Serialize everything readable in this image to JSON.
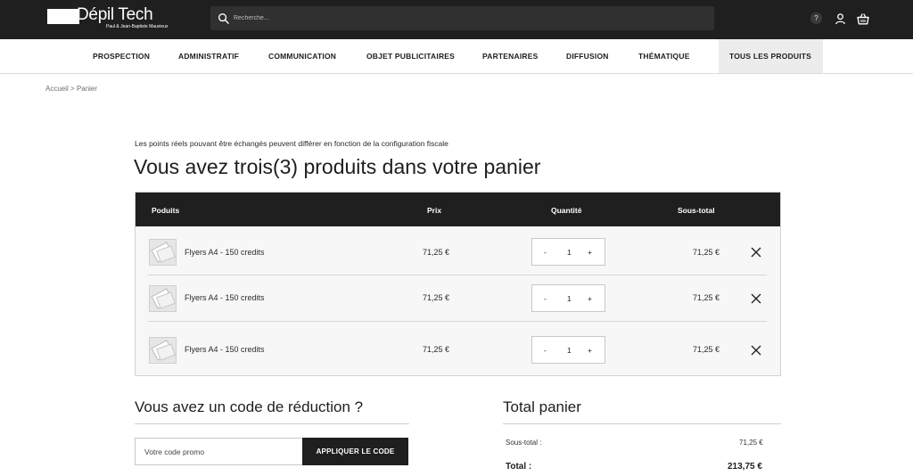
{
  "brand": {
    "name": "Dépil Tech",
    "tagline": "Paul & Jean-Baptiste Mauvieux"
  },
  "search": {
    "placeholder": "Recherche..."
  },
  "header_icons": {
    "help": "?",
    "user_icon": "user-icon",
    "basket_icon": "basket-icon"
  },
  "nav": {
    "items": [
      {
        "label": "PROSPECTION"
      },
      {
        "label": "ADMINISTRATIF"
      },
      {
        "label": "COMMUNICATION"
      },
      {
        "label": "OBJET PUBLICITAIRES"
      },
      {
        "label": "PARTENAIRES"
      },
      {
        "label": "DIFFUSION"
      },
      {
        "label": "THÉMATIQUE"
      },
      {
        "label": "TOUS LES PRODUITS"
      }
    ],
    "active_index": 7
  },
  "breadcrumb": "Accueil > Panier",
  "cart": {
    "notice": "Les points réels pouvant être échangés peuvent différer en fonction de la configuration fiscale",
    "title": "Vous avez trois(3) produits dans votre panier",
    "columns": {
      "product": "Poduits",
      "price": "Prix",
      "quantity": "Quantité",
      "subtotal": "Sous-total"
    },
    "items": [
      {
        "name": "Flyers A4 - 150 credits",
        "price": "71,25 €",
        "qty": "1",
        "subtotal": "71,25 €"
      },
      {
        "name": "Flyers A4 - 150 credits",
        "price": "71,25 €",
        "qty": "1",
        "subtotal": "71,25 €"
      },
      {
        "name": "Flyers A4 - 150 credits",
        "price": "71,25 €",
        "qty": "1",
        "subtotal": "71,25 €"
      }
    ],
    "qty_minus": "-",
    "qty_plus": "+"
  },
  "discount": {
    "title": "Vous avez un code de réduction ?",
    "placeholder": "Votre code promo",
    "button": "APPLIQUER LE CODE"
  },
  "totals": {
    "title": "Total panier",
    "subtotal_label": "Sous-total :",
    "subtotal_value": "71,25 €",
    "total_label": "Total :",
    "total_value": "213,75 €"
  },
  "colors": {
    "header_bg": "#1f1f1f",
    "active_nav_bg": "#ececec",
    "table_bg": "#f7f7f7"
  }
}
